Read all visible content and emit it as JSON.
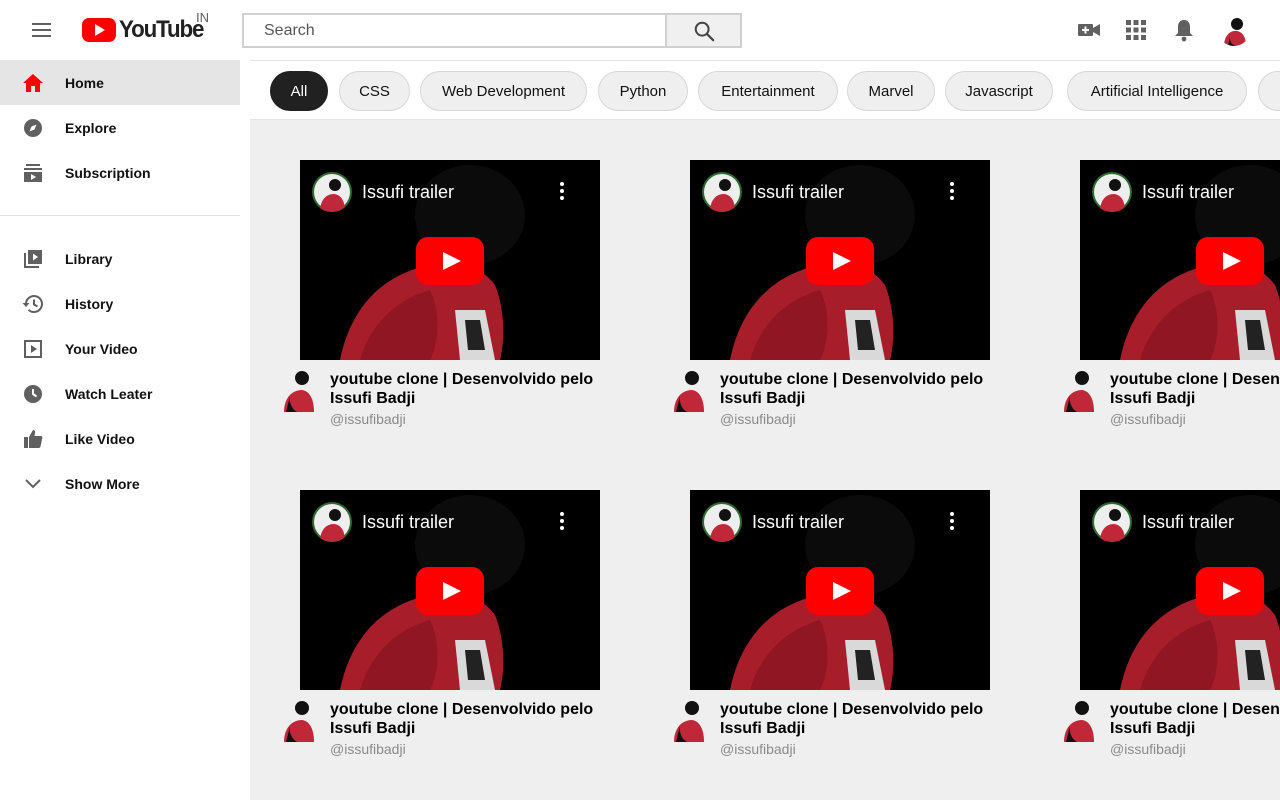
{
  "header": {
    "logo_text": "YouTube",
    "country": "IN",
    "search_placeholder": "Search",
    "icons": [
      "menu-icon",
      "search-icon",
      "video-camera-icon",
      "apps-grid-icon",
      "bell-icon",
      "avatar"
    ]
  },
  "sidebar": {
    "items": [
      {
        "label": "Home",
        "icon": "home-icon",
        "active": true
      },
      {
        "label": "Explore",
        "icon": "compass-icon"
      },
      {
        "label": "Subscription",
        "icon": "subscriptions-icon"
      },
      {
        "label": "Library",
        "icon": "library-icon"
      },
      {
        "label": "History",
        "icon": "history-icon"
      },
      {
        "label": "Your Video",
        "icon": "your-video-icon"
      },
      {
        "label": "Watch Leater",
        "icon": "clock-icon"
      },
      {
        "label": "Like Video",
        "icon": "thumbs-up-icon"
      },
      {
        "label": "Show More",
        "icon": "chevron-down-icon"
      }
    ]
  },
  "chips": [
    "All",
    "CSS",
    "Web Development",
    "Python",
    "Entertainment",
    "Marvel",
    "Javascript",
    "Artificial Intelligence"
  ],
  "videos": [
    {
      "thumb_title": "Issufi trailer",
      "title": "youtube clone | Desenvolvido pelo Issufi Badji",
      "channel": "@issufibadji"
    },
    {
      "thumb_title": "Issufi trailer",
      "title": "youtube clone | Desenvolvido pelo Issufi Badji",
      "channel": "@issufibadji"
    },
    {
      "thumb_title": "Issufi trailer",
      "title": "youtube clone | Desenvolvido pelo Issufi Badji",
      "channel": "@issufibadji"
    },
    {
      "thumb_title": "Issufi trailer",
      "title": "youtube clone | Desenvolvido pelo Issufi Badji",
      "channel": "@issufibadji"
    },
    {
      "thumb_title": "Issufi trailer",
      "title": "youtube clone | Desenvolvido pelo Issufi Badji",
      "channel": "@issufibadji"
    },
    {
      "thumb_title": "Issufi trailer",
      "title": "youtube clone | Desenvolvido pelo Issufi Badji",
      "channel": "@issufibadji"
    }
  ],
  "colors": {
    "brand_red": "#ff0000",
    "chip_active": "#212121",
    "content_bg": "#efefef"
  }
}
